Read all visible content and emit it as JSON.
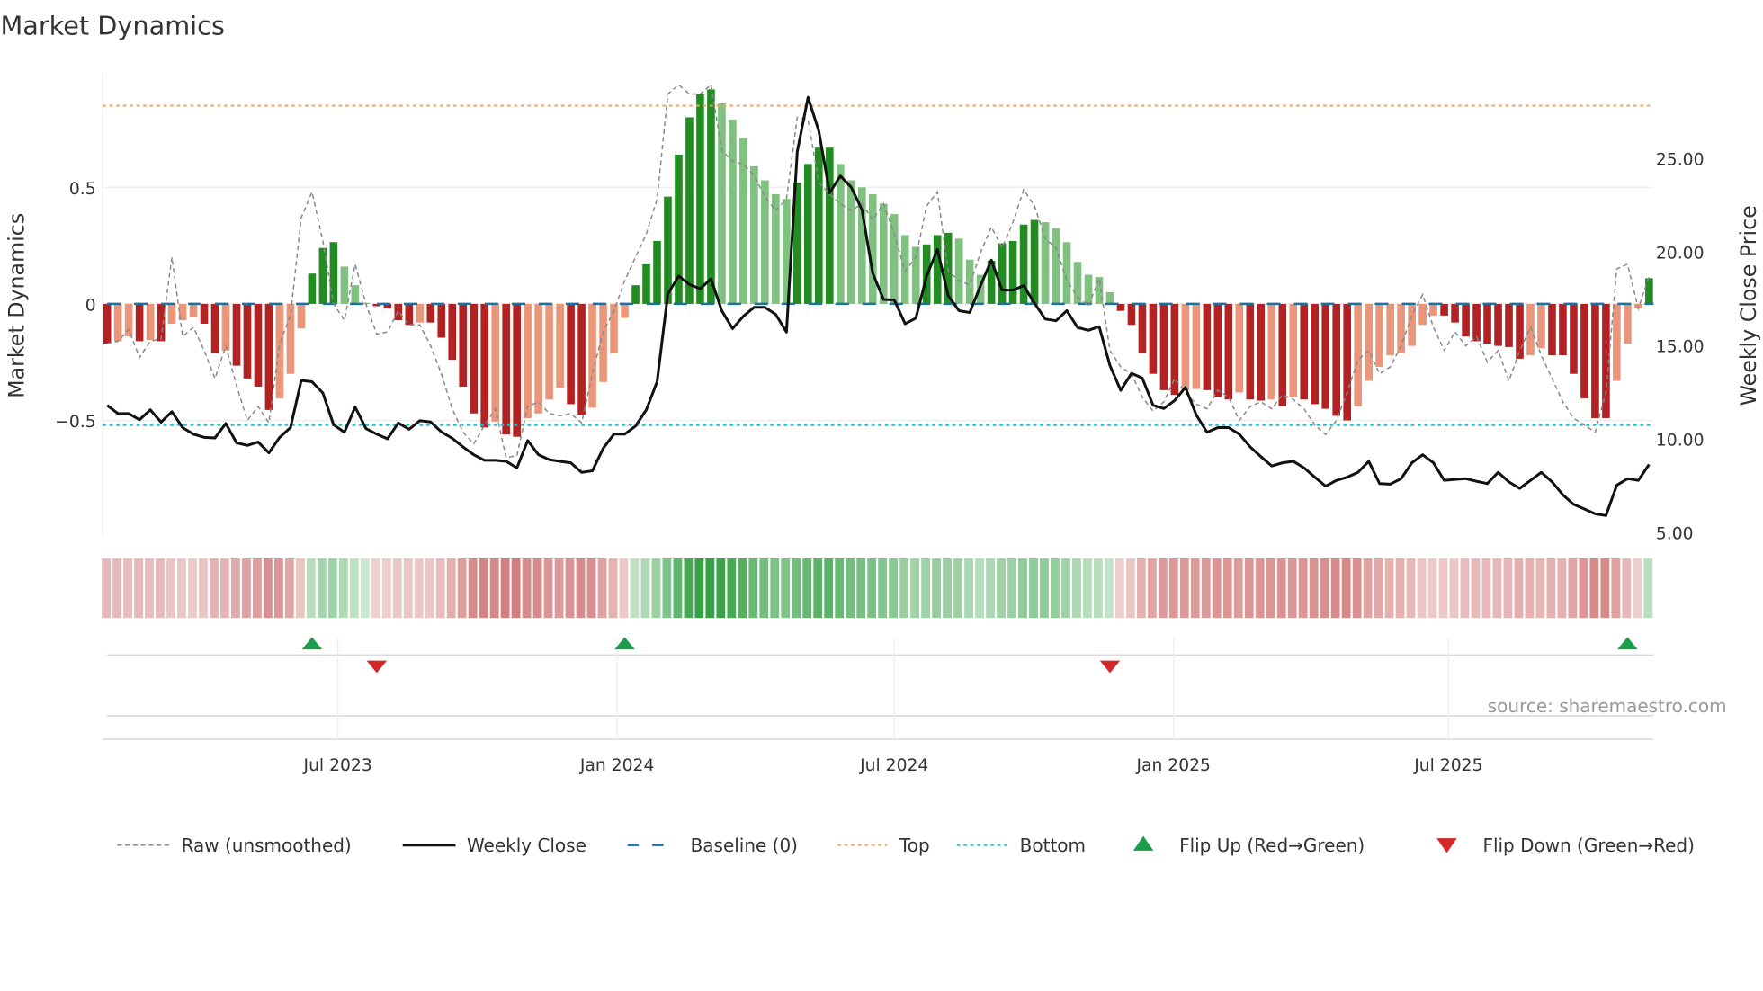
{
  "title": "Market Dynamics",
  "source": "source: sharemaestro.com",
  "colors": {
    "dark_green": "#228b22",
    "light_green": "#80c080",
    "dark_red": "#b22222",
    "light_red": "#e9967a",
    "baseline": "#1f6f9f",
    "top": "#f4a460",
    "bottom": "#20c0d0",
    "raw": "#888888",
    "close": "#111111",
    "flip_up": "#1a9e4a",
    "flip_down": "#d62728"
  },
  "legend": [
    {
      "label": "Raw (unsmoothed)",
      "key": "raw"
    },
    {
      "label": "Weekly Close",
      "key": "close"
    },
    {
      "label": "Baseline (0)",
      "key": "baseline"
    },
    {
      "label": "Top",
      "key": "top"
    },
    {
      "label": "Bottom",
      "key": "bottom"
    },
    {
      "label": "Flip Up (Red→Green)",
      "key": "flip_up"
    },
    {
      "label": "Flip Down (Green→Red)",
      "key": "flip_down"
    }
  ],
  "chart_data": {
    "type": "bar",
    "title": "Market Dynamics",
    "ylabel": "Market Dynamics",
    "y2label": "Weekly Close Price",
    "ylim": [
      -1.0,
      0.99
    ],
    "y2lim": [
      4.7,
      29.5
    ],
    "y_ticks": [
      {
        "value": 0.5,
        "label": "0.5"
      },
      {
        "value": 0,
        "label": "0"
      },
      {
        "value": -0.5,
        "label": "−0.5"
      }
    ],
    "y2_ticks": [
      {
        "value": 25,
        "label": "25.00"
      },
      {
        "value": 20,
        "label": "20.00"
      },
      {
        "value": 15,
        "label": "15.00"
      },
      {
        "value": 10,
        "label": "10.00"
      },
      {
        "value": 5,
        "label": "5.00"
      }
    ],
    "x_ticks": [
      {
        "label": "Jul 2023",
        "week": 21.4
      },
      {
        "label": "Jan 2024",
        "week": 47.3
      },
      {
        "label": "Jul 2024",
        "week": 73.0
      },
      {
        "label": "Jan 2025",
        "week": 98.9
      },
      {
        "label": "Jul 2025",
        "week": 124.4
      }
    ],
    "top": 0.85,
    "bottom": -0.52,
    "baseline": 0,
    "dynamics": [
      -0.17,
      -0.16,
      -0.14,
      -0.16,
      -0.155,
      -0.16,
      -0.085,
      -0.07,
      -0.055,
      -0.085,
      -0.21,
      -0.2,
      -0.265,
      -0.32,
      -0.355,
      -0.455,
      -0.405,
      -0.3,
      -0.105,
      0.13,
      0.24,
      0.265,
      0.16,
      0.08,
      0.005,
      -0.01,
      -0.02,
      -0.07,
      -0.09,
      -0.08,
      -0.08,
      -0.145,
      -0.24,
      -0.355,
      -0.47,
      -0.53,
      -0.505,
      -0.56,
      -0.57,
      -0.49,
      -0.47,
      -0.41,
      -0.36,
      -0.43,
      -0.475,
      -0.445,
      -0.335,
      -0.21,
      -0.06,
      0.08,
      0.17,
      0.27,
      0.46,
      0.64,
      0.8,
      0.9,
      0.92,
      0.86,
      0.79,
      0.71,
      0.59,
      0.53,
      0.47,
      0.45,
      0.52,
      0.6,
      0.67,
      0.67,
      0.6,
      0.53,
      0.5,
      0.47,
      0.43,
      0.385,
      0.295,
      0.245,
      0.255,
      0.295,
      0.305,
      0.28,
      0.19,
      0.125,
      0.185,
      0.26,
      0.27,
      0.34,
      0.36,
      0.35,
      0.325,
      0.265,
      0.18,
      0.125,
      0.115,
      0.05,
      -0.03,
      -0.09,
      -0.21,
      -0.3,
      -0.37,
      -0.39,
      -0.37,
      -0.365,
      -0.37,
      -0.4,
      -0.41,
      -0.38,
      -0.41,
      -0.415,
      -0.41,
      -0.44,
      -0.4,
      -0.41,
      -0.43,
      -0.45,
      -0.48,
      -0.5,
      -0.44,
      -0.33,
      -0.27,
      -0.22,
      -0.21,
      -0.18,
      -0.09,
      -0.05,
      -0.05,
      -0.08,
      -0.14,
      -0.16,
      -0.17,
      -0.18,
      -0.185,
      -0.235,
      -0.22,
      -0.19,
      -0.22,
      -0.22,
      -0.3,
      -0.405,
      -0.49,
      -0.49,
      -0.33,
      -0.17,
      -0.02,
      0.11
    ],
    "raw": [
      -0.17,
      -0.16,
      -0.11,
      -0.23,
      -0.16,
      -0.15,
      0.2,
      -0.14,
      -0.1,
      -0.2,
      -0.32,
      -0.18,
      -0.35,
      -0.5,
      -0.44,
      -0.51,
      -0.17,
      -0.05,
      0.37,
      0.48,
      0.27,
      0.0,
      -0.07,
      0.17,
      0.0,
      -0.13,
      -0.12,
      -0.03,
      -0.09,
      -0.09,
      -0.18,
      -0.3,
      -0.45,
      -0.55,
      -0.6,
      -0.52,
      -0.45,
      -0.66,
      -0.65,
      -0.44,
      -0.42,
      -0.47,
      -0.48,
      -0.47,
      -0.51,
      -0.3,
      -0.12,
      -0.03,
      0.1,
      0.2,
      0.3,
      0.45,
      0.9,
      0.94,
      0.9,
      0.9,
      0.94,
      0.66,
      0.61,
      0.6,
      0.55,
      0.46,
      0.4,
      0.45,
      0.8,
      0.79,
      0.52,
      0.47,
      0.43,
      0.4,
      0.43,
      0.36,
      0.43,
      0.3,
      0.14,
      0.2,
      0.42,
      0.48,
      0.14,
      0.1,
      0.08,
      0.22,
      0.33,
      0.24,
      0.35,
      0.49,
      0.42,
      0.28,
      0.24,
      0.1,
      0.03,
      -0.01,
      0.11,
      -0.2,
      -0.27,
      -0.3,
      -0.4,
      -0.46,
      -0.42,
      -0.32,
      -0.38,
      -0.43,
      -0.45,
      -0.37,
      -0.4,
      -0.5,
      -0.44,
      -0.42,
      -0.45,
      -0.39,
      -0.41,
      -0.45,
      -0.52,
      -0.56,
      -0.5,
      -0.38,
      -0.24,
      -0.2,
      -0.3,
      -0.27,
      -0.18,
      -0.05,
      0.04,
      -0.1,
      -0.2,
      -0.12,
      -0.18,
      -0.14,
      -0.25,
      -0.2,
      -0.33,
      -0.2,
      -0.1,
      -0.22,
      -0.32,
      -0.42,
      -0.49,
      -0.52,
      -0.55,
      -0.38,
      0.15,
      0.17,
      -0.02,
      0.12
    ],
    "close": [
      11.74,
      11.3,
      11.3,
      10.97,
      11.5,
      10.84,
      11.4,
      10.55,
      10.2,
      10.03,
      10.0,
      10.77,
      9.74,
      9.6,
      9.78,
      9.2,
      10.03,
      10.55,
      13.07,
      13.0,
      12.4,
      10.7,
      10.3,
      11.65,
      10.5,
      10.2,
      9.95,
      10.8,
      10.46,
      10.92,
      10.85,
      10.32,
      9.98,
      9.52,
      9.1,
      8.8,
      8.8,
      8.75,
      8.4,
      9.86,
      9.1,
      8.84,
      8.75,
      8.67,
      8.16,
      8.24,
      9.44,
      10.2,
      10.2,
      10.63,
      11.5,
      13.0,
      17.7,
      18.65,
      18.2,
      17.97,
      18.5,
      16.8,
      15.84,
      16.5,
      16.98,
      16.98,
      16.6,
      15.66,
      25.3,
      28.2,
      26.4,
      23.1,
      24.0,
      23.4,
      22.2,
      18.8,
      17.4,
      17.37,
      16.1,
      16.4,
      18.65,
      20.07,
      17.6,
      16.8,
      16.7,
      18.14,
      19.5,
      17.9,
      17.9,
      18.14,
      17.2,
      16.35,
      16.26,
      16.8,
      15.9,
      15.75,
      15.95,
      13.87,
      12.54,
      13.45,
      13.2,
      11.74,
      11.57,
      12.0,
      12.7,
      11.23,
      10.3,
      10.55,
      10.55,
      10.2,
      9.52,
      9.0,
      8.5,
      8.67,
      8.75,
      8.4,
      7.9,
      7.42,
      7.73,
      7.9,
      8.16,
      8.75,
      7.56,
      7.53,
      7.82,
      8.67,
      9.1,
      8.67,
      7.73,
      7.78,
      7.82,
      7.68,
      7.56,
      8.16,
      7.65,
      7.3,
      7.73,
      8.16,
      7.65,
      6.96,
      6.45,
      6.2,
      5.94,
      5.85,
      7.47,
      7.82,
      7.73,
      8.58
    ],
    "flips": [
      {
        "type": "up",
        "week": 19
      },
      {
        "type": "down",
        "week": 25
      },
      {
        "type": "up",
        "week": 48
      },
      {
        "type": "down",
        "week": 93
      },
      {
        "type": "up",
        "week": 141
      }
    ]
  }
}
